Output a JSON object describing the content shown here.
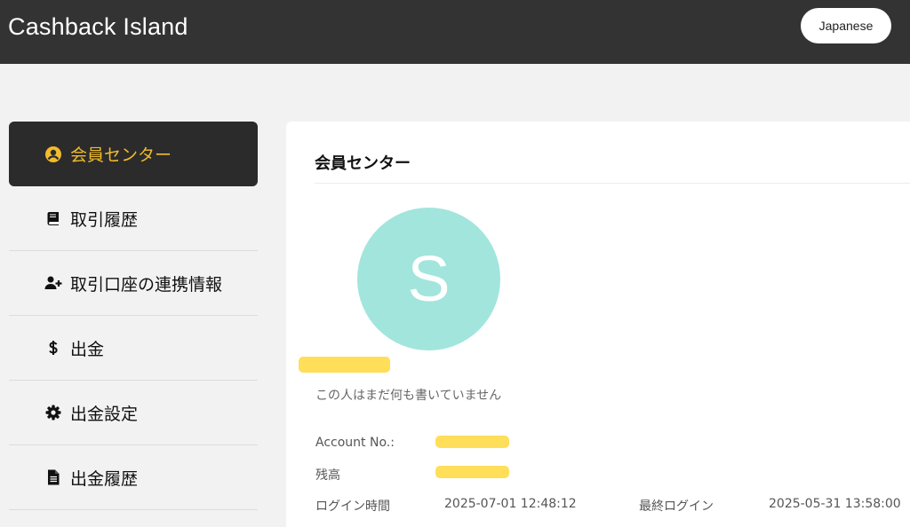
{
  "header": {
    "brand": "Cashback Island",
    "language_button": "Japanese"
  },
  "sidebar": {
    "items": [
      {
        "label": "会員センター",
        "icon": "user-circle-icon",
        "active": true
      },
      {
        "label": "取引履歴",
        "icon": "book-icon",
        "active": false
      },
      {
        "label": "取引口座の連携情報",
        "icon": "user-plus-icon",
        "active": false
      },
      {
        "label": "出金",
        "icon": "dollar-icon",
        "active": false
      },
      {
        "label": "出金設定",
        "icon": "gear-icon",
        "active": false
      },
      {
        "label": "出金履歴",
        "icon": "file-text-icon",
        "active": false
      }
    ]
  },
  "main": {
    "title": "会員センター",
    "avatar_letter": "S",
    "bio": "この人はまだ何も書いていません",
    "account_label": "Account No.:",
    "balance_label": "残高",
    "login_time_label": "ログイン時間",
    "login_time_value": "2025-07-01 12:48:12",
    "last_login_label": "最終ログイン",
    "last_login_value": "2025-05-31 13:58:00"
  },
  "colors": {
    "header_bg": "#333333",
    "active_nav_bg": "#2b2b2b",
    "active_nav_text": "#f1bb2b",
    "avatar_bg": "#a2e5dd",
    "redaction": "#ffde59"
  }
}
